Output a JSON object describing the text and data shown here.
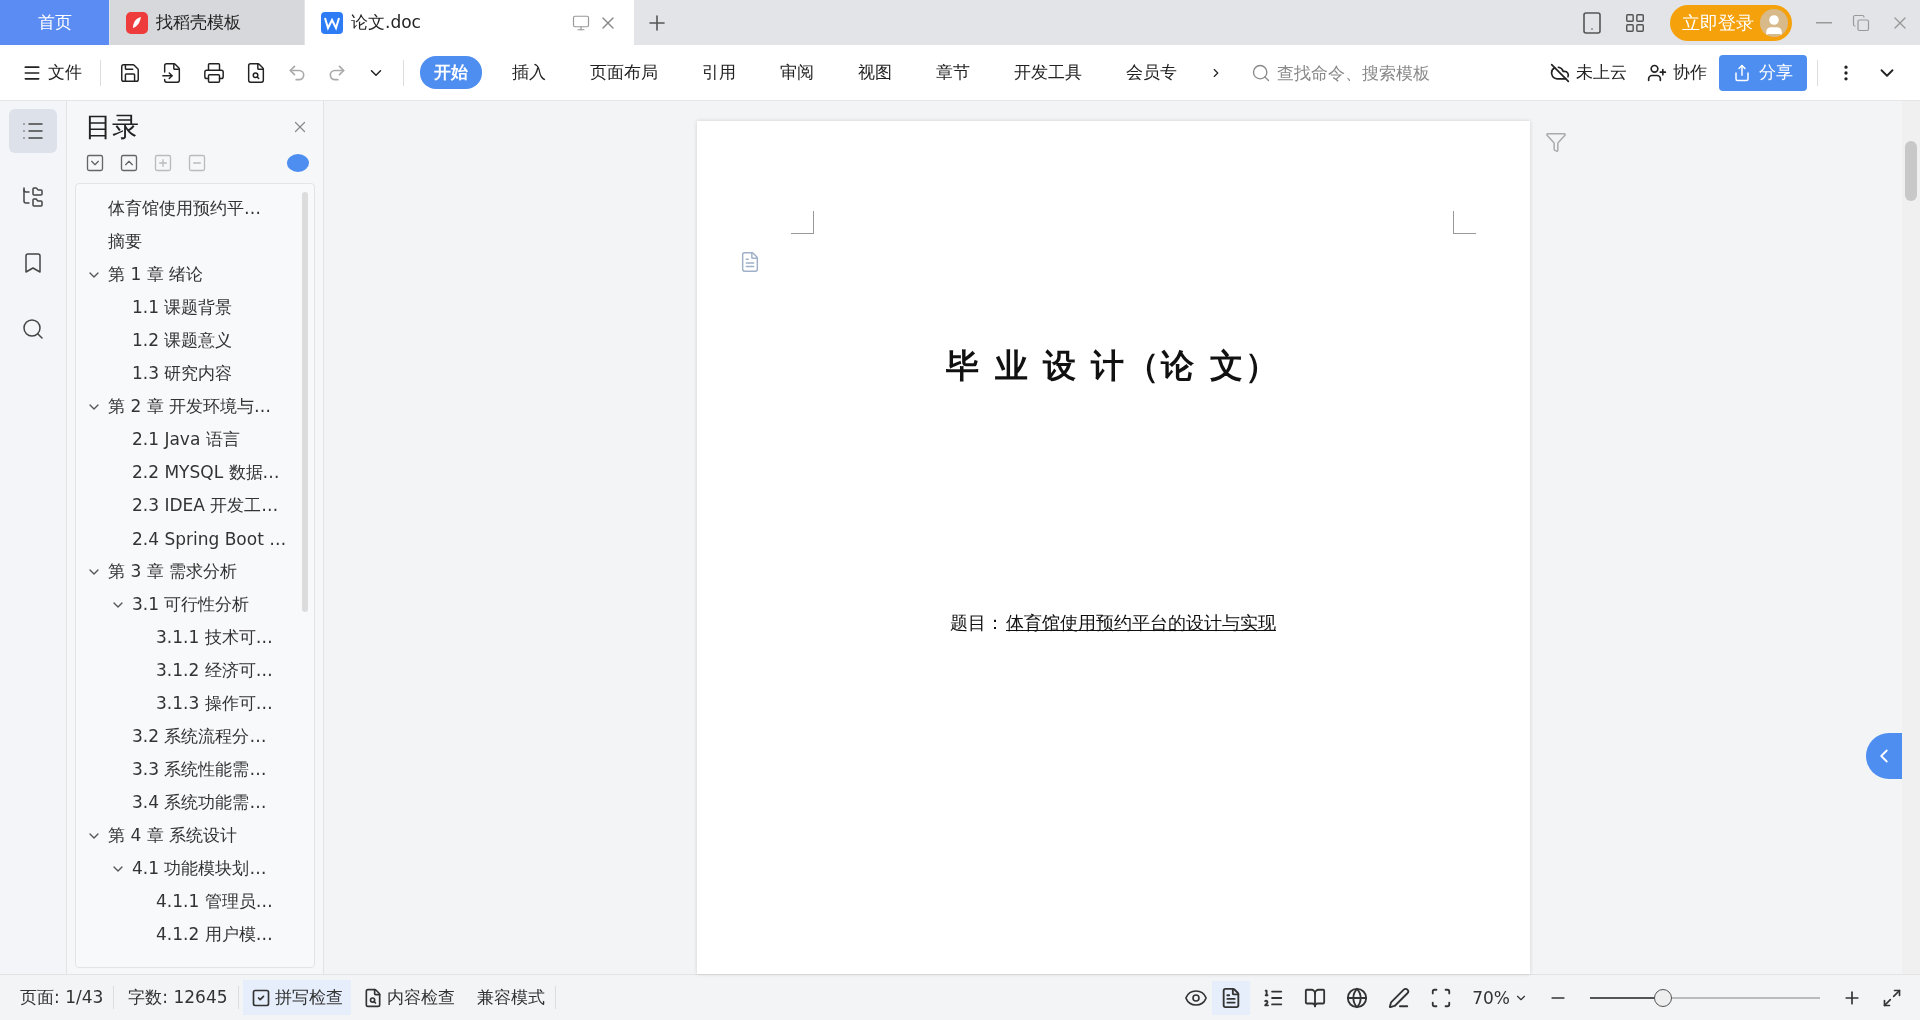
{
  "tabs": [
    {
      "kind": "home",
      "label": "首页",
      "selected": false
    },
    {
      "kind": "template",
      "label": "找稻壳模板",
      "selected": false
    },
    {
      "kind": "doc",
      "label": "论文.doc",
      "selected": true
    }
  ],
  "login_button": "立即登录",
  "file_menu": "文件",
  "ribbon_tabs": [
    {
      "label": "开始",
      "selected": true
    },
    {
      "label": "插入",
      "selected": false
    },
    {
      "label": "页面布局",
      "selected": false
    },
    {
      "label": "引用",
      "selected": false
    },
    {
      "label": "审阅",
      "selected": false
    },
    {
      "label": "视图",
      "selected": false
    },
    {
      "label": "章节",
      "selected": false
    },
    {
      "label": "开发工具",
      "selected": false
    },
    {
      "label": "会员专",
      "selected": false
    }
  ],
  "search": {
    "placeholder": "查找命令、搜索模板"
  },
  "cloud_status": "未上云",
  "collaborate": "协作",
  "share": "分享",
  "toc": {
    "title": "目录",
    "items": [
      {
        "title": "体育馆使用预约平…"
      },
      {
        "title": "摘要"
      },
      {
        "title": "第 1 章  绪论",
        "expanded": true,
        "children": [
          {
            "title": "1.1  课题背景"
          },
          {
            "title": "1.2  课题意义"
          },
          {
            "title": "1.3  研究内容"
          }
        ]
      },
      {
        "title": "第 2 章  开发环境与…",
        "expanded": true,
        "children": [
          {
            "title": "2.1 Java 语言"
          },
          {
            "title": "2.2 MYSQL 数据…"
          },
          {
            "title": "2.3 IDEA 开发工…"
          },
          {
            "title": "2.4 Spring Boot  …"
          }
        ]
      },
      {
        "title": "第 3 章  需求分析",
        "expanded": true,
        "children": [
          {
            "title": "3.1  可行性分析",
            "expanded": true,
            "children": [
              {
                "title": "3.1.1  技术可…"
              },
              {
                "title": "3.1.2  经济可…"
              },
              {
                "title": "3.1.3  操作可…"
              }
            ]
          },
          {
            "title": "3.2  系统流程分…"
          },
          {
            "title": "3.3  系统性能需…"
          },
          {
            "title": "3.4  系统功能需…"
          }
        ]
      },
      {
        "title": "第 4 章  系统设计",
        "expanded": true,
        "children": [
          {
            "title": "4.1  功能模块划…",
            "expanded": true,
            "children": [
              {
                "title": "4.1.1  管理员…"
              },
              {
                "title": "4.1.2  用户模…"
              }
            ]
          }
        ]
      }
    ]
  },
  "document": {
    "heading": "毕 业 设 计（论 文）",
    "subject_label": "题目：",
    "subject": "体育馆使用预约平台的设计与实现"
  },
  "status_bar": {
    "page": "页面: 1/43",
    "words": "字数: 12645",
    "spell_check": "拼写检查",
    "content_check": "内容检查",
    "compat_mode": "兼容模式",
    "zoom": "70%",
    "zoom_level": {
      "level": 0.3
    }
  }
}
